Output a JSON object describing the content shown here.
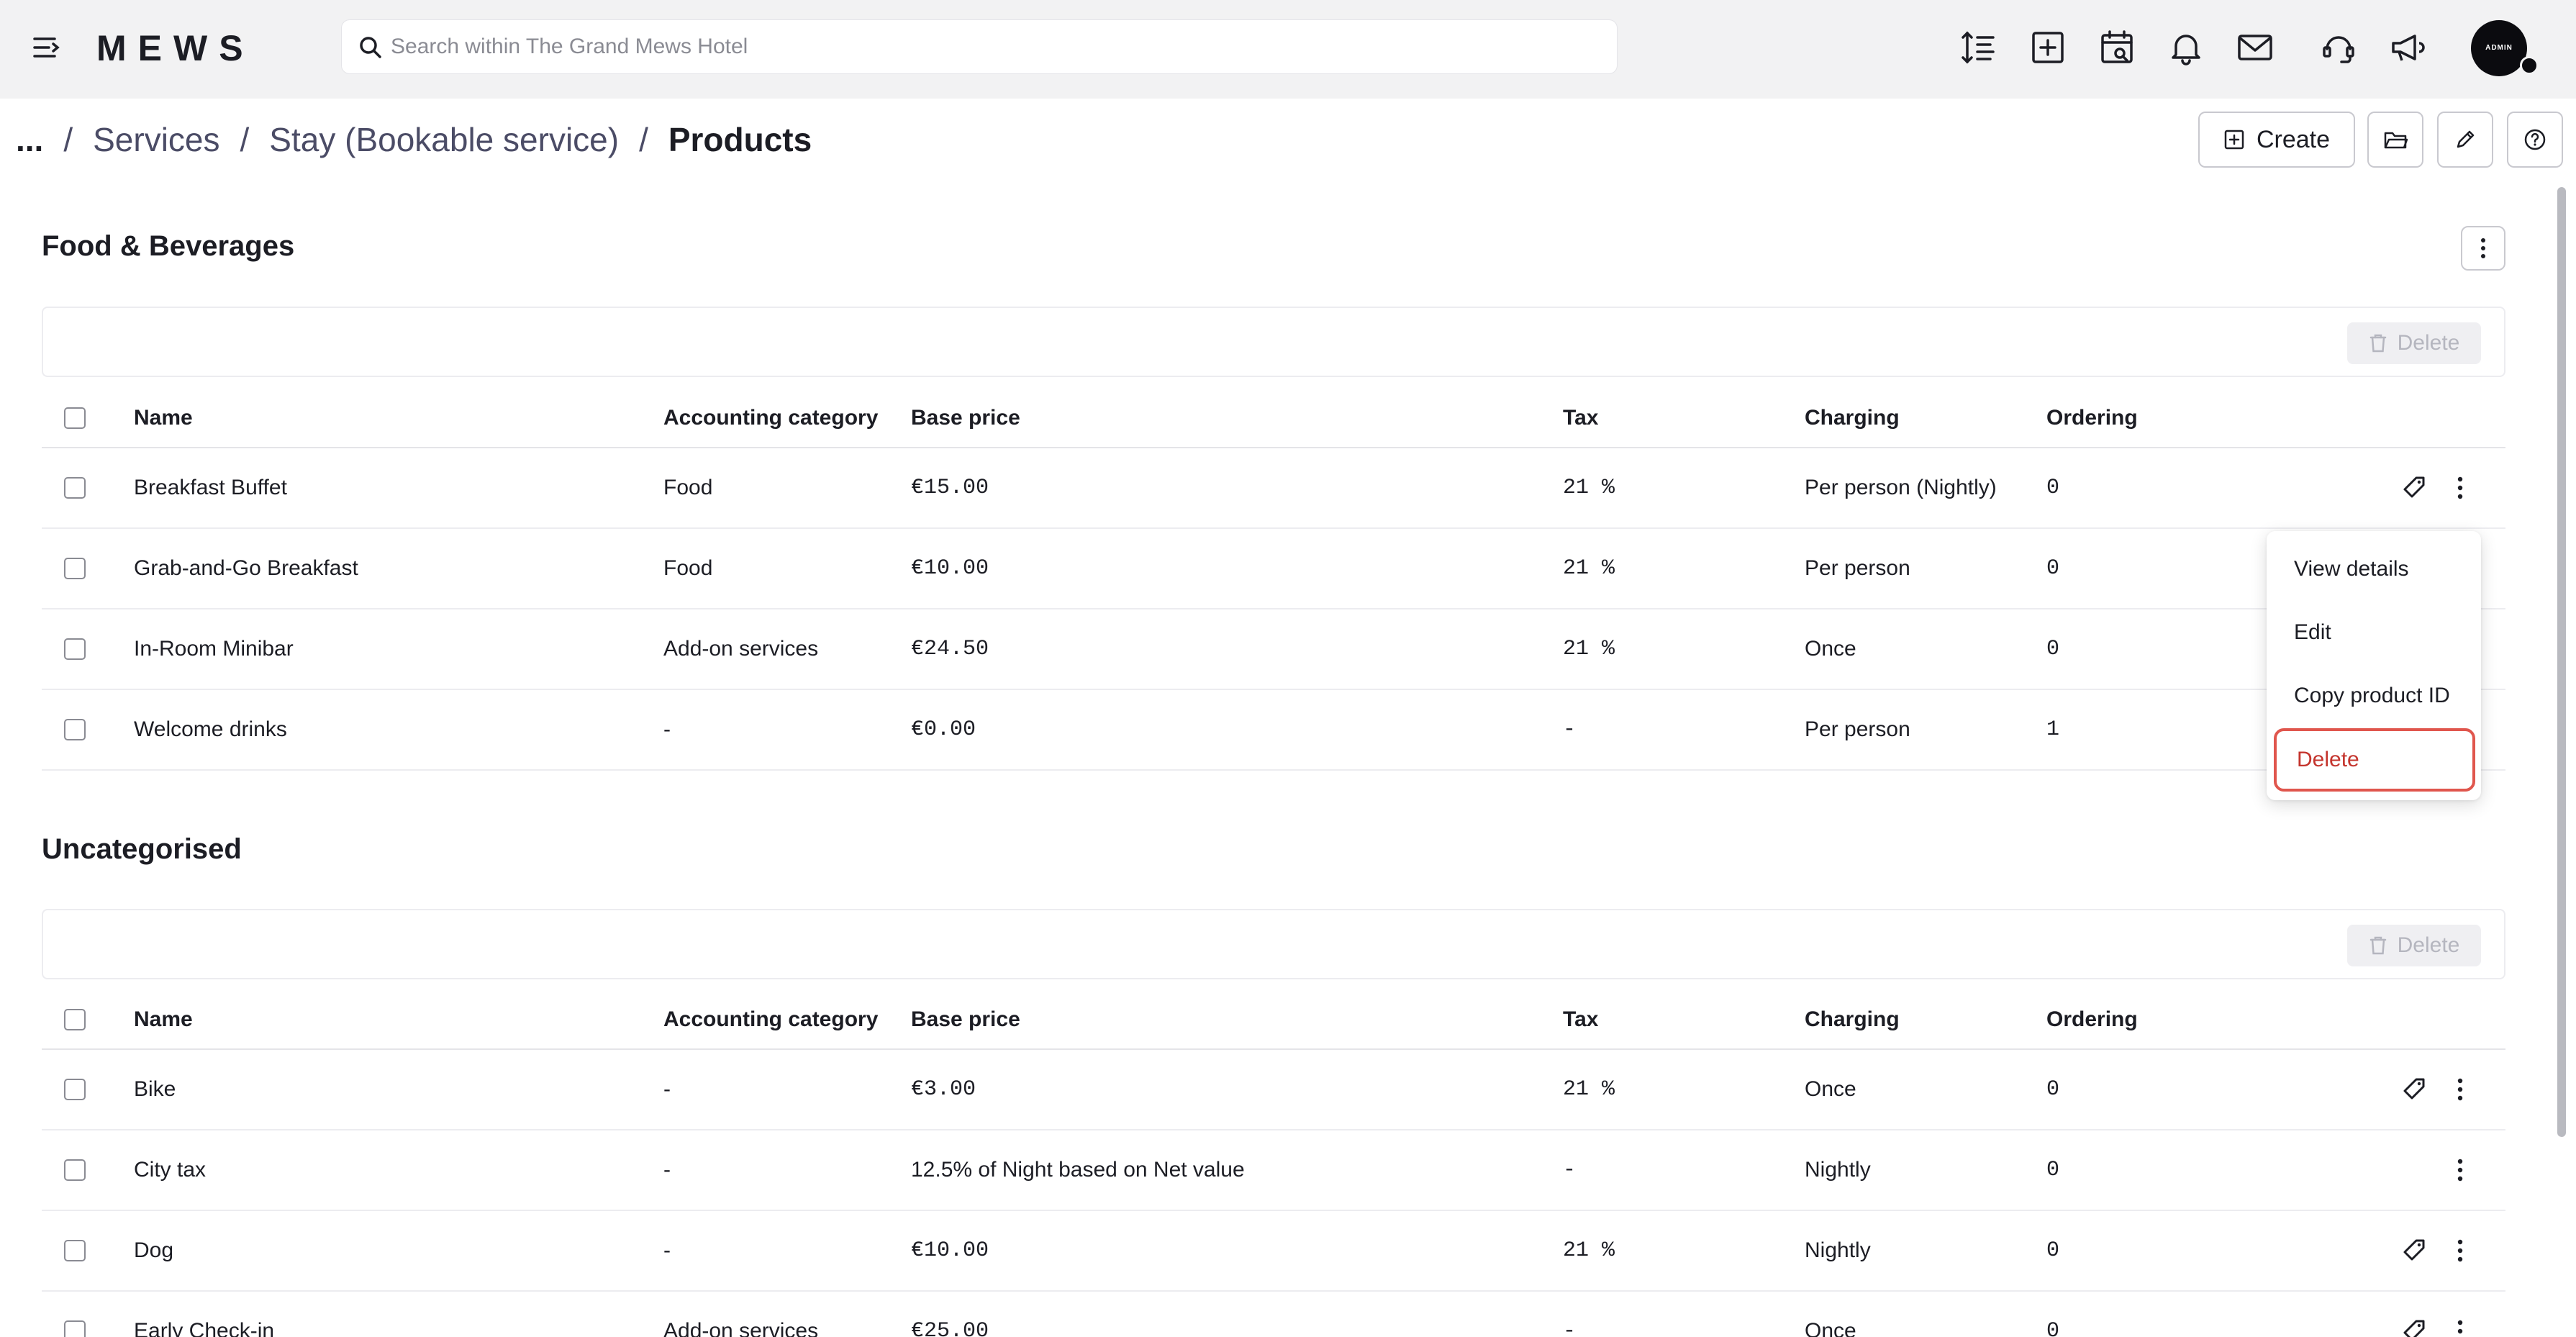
{
  "header": {
    "logo": "MEWS",
    "search_placeholder": "Search within The Grand Mews Hotel",
    "avatar_label": "ADMIN",
    "icons": [
      "menu-collapse-icon",
      "search-icon",
      "sort-lines-icon",
      "add-square-icon",
      "calendar-icon",
      "bell-icon",
      "mail-icon",
      "support-icon",
      "megaphone-icon"
    ]
  },
  "breadcrumb": {
    "ellipsis": "...",
    "separator": "/",
    "items": [
      "Services",
      "Stay (Bookable service)"
    ],
    "current": "Products"
  },
  "actions": {
    "create_label": "Create",
    "icons": [
      "folder-icon",
      "pencil-icon",
      "help-icon"
    ]
  },
  "columns": {
    "name": "Name",
    "accounting": "Accounting category",
    "price": "Base price",
    "tax": "Tax",
    "charging": "Charging",
    "ordering": "Ordering"
  },
  "sections": [
    {
      "title": "Food & Beverages",
      "delete_label": "Delete",
      "rows": [
        {
          "name": "Breakfast Buffet",
          "accounting": "Food",
          "price": "€15.00",
          "tax": "21 %",
          "charging": "Per person (Nightly)",
          "ordering": "0",
          "tag": true
        },
        {
          "name": "Grab-and-Go Breakfast",
          "accounting": "Food",
          "price": "€10.00",
          "tax": "21 %",
          "charging": "Per person",
          "ordering": "0",
          "tag": false
        },
        {
          "name": "In-Room Minibar",
          "accounting": "Add-on services",
          "price": "€24.50",
          "tax": "21 %",
          "charging": "Once",
          "ordering": "0",
          "tag": false
        },
        {
          "name": "Welcome drinks",
          "accounting": "-",
          "price": "€0.00",
          "tax": "-",
          "charging": "Per person",
          "ordering": "1",
          "tag": false
        }
      ]
    },
    {
      "title": "Uncategorised",
      "delete_label": "Delete",
      "rows": [
        {
          "name": "Bike",
          "accounting": "-",
          "price": "€3.00",
          "tax": "21 %",
          "charging": "Once",
          "ordering": "0",
          "tag": true
        },
        {
          "name": "City tax",
          "accounting": "-",
          "price": "12.5% of Night based on Net value",
          "tax": "-",
          "charging": "Nightly",
          "ordering": "0",
          "tag": false
        },
        {
          "name": "Dog",
          "accounting": "-",
          "price": "€10.00",
          "tax": "21 %",
          "charging": "Nightly",
          "ordering": "0",
          "tag": true
        },
        {
          "name": "Early Check-in",
          "accounting": "Add-on services",
          "price": "€25.00",
          "tax": "-",
          "charging": "Once",
          "ordering": "0",
          "tag": true
        }
      ]
    }
  ],
  "context_menu": {
    "items": [
      "View details",
      "Edit",
      "Copy product ID"
    ],
    "delete": "Delete"
  },
  "colors": {
    "topbar_bg": "#f2f2f3",
    "text": "#1c1d24",
    "breadcrumb_link": "#4b4c66",
    "danger": "#c4342d",
    "danger_border": "#e0564d"
  }
}
